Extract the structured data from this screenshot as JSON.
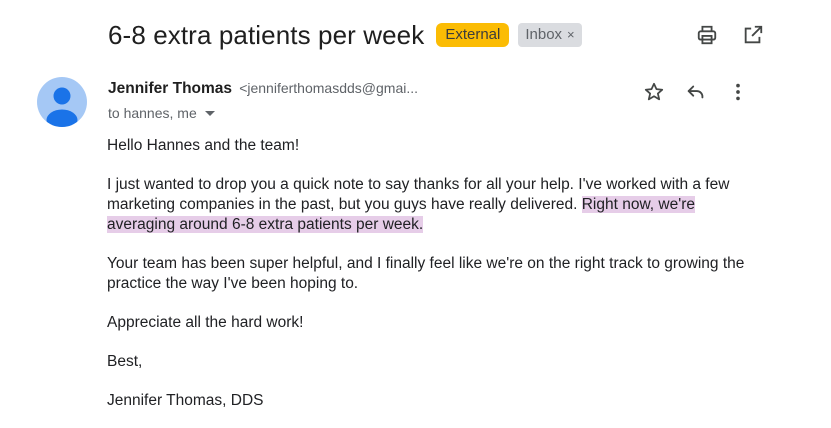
{
  "subject": "6-8 extra patients per week",
  "labels": {
    "external": "External",
    "inbox": "Inbox",
    "inbox_remove": "×"
  },
  "sender": {
    "name": "Jennifer Thomas",
    "email": "<jenniferthomasdds@gmai..."
  },
  "recipients": "to hannes, me",
  "body": {
    "greeting": "Hello Hannes and the team!",
    "para1_a": "I just wanted to drop you a quick note to say thanks for all your help. I've worked with a few marketing companies in the past, but you guys have really delivered. ",
    "para1_highlight": "Right now, we're averaging around 6-8 extra patients per week.",
    "para2": "Your team has been super helpful, and I finally feel like we're on the right track to growing the practice the way I've been hoping to.",
    "para3": "Appreciate all the hard work!",
    "closing": "Best,",
    "signature": "Jennifer Thomas, DDS"
  },
  "icons": {
    "print": "print-icon",
    "open_new": "open-in-new-window-icon",
    "star": "star-icon",
    "reply": "reply-icon",
    "more": "more-vertical-icon",
    "avatar": "default-avatar-icon",
    "caret": "chevron-down-icon"
  },
  "colors": {
    "external_badge": "#fbbc04",
    "inbox_badge": "#dadce0",
    "highlight": "#e6cde8",
    "avatar_bg": "#a5c8f5",
    "avatar_fg": "#1a73e8"
  }
}
